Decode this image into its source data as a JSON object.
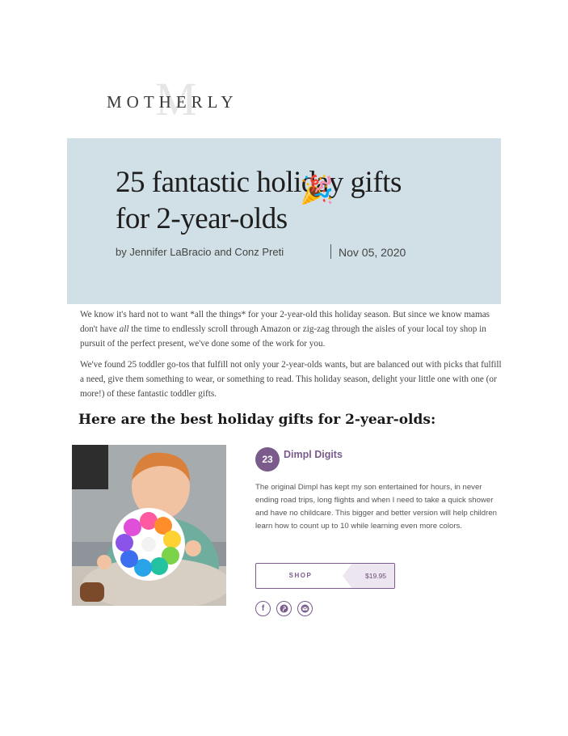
{
  "brand": {
    "logo_text": "MOTHERLY",
    "logo_monogram": "M"
  },
  "hero": {
    "title_line1": "25 fantastic holiday gifts",
    "title_line2": "for 2-year-olds",
    "title_emoji": "🎉",
    "byline": "by Jennifer LaBracio and Conz Preti",
    "date": "Nov 05, 2020",
    "background_color": "#d1e0e6"
  },
  "intro": {
    "p1_a": "We know it's hard not to want *all the things* for your 2-year-old this holiday season. But since we know mamas don't have ",
    "p1_em": "all",
    "p1_b": " the time to endlessly scroll through Amazon or zig-zag through the aisles of your local toy shop in pursuit of the perfect present, we've done some of the work for you.",
    "p2": "We've found 25 toddler go-tos that fulfill not only your 2-year-olds wants, but are balanced out with picks that fulfill a need, give them something to wear, or something to read. This holiday season, delight your little one with one (or more!) of these fantastic toddler gifts."
  },
  "section_heading": "Here are the best holiday gifts for 2-year-olds:",
  "product": {
    "rank": "23",
    "name": "Dimpl Digits",
    "description": "The original Dimpl has kept my son entertained for hours, in never ending road trips, long flights and when I need to take a quick shower and have no childcare. This bigger and better version will help children learn how to count up to 10 while learning even more colors.",
    "shop_label": "SHOP",
    "price": "$19.95",
    "accent_color": "#7a5b8c"
  },
  "share": {
    "facebook_icon": "facebook-icon",
    "pinterest_icon": "pinterest-icon",
    "email_icon": "email-icon"
  }
}
